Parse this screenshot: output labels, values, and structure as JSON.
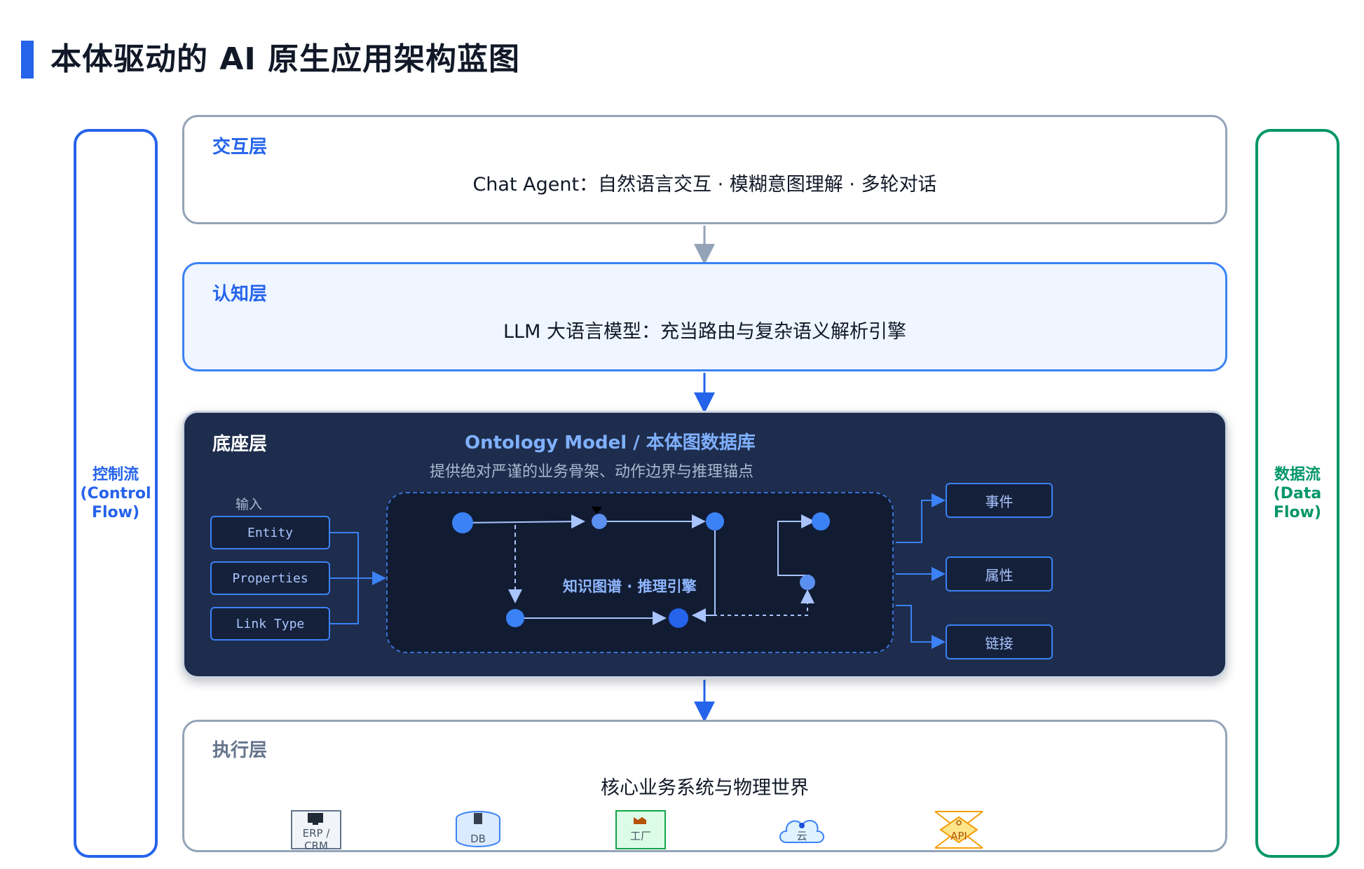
{
  "page": {
    "title": "本体驱动的 AI 原生应用架构蓝图"
  },
  "side": {
    "control": "控制流\n(Control\nFlow)",
    "data": "数据流\n(Data Flow)"
  },
  "layers": {
    "interaction": {
      "title": "交互层",
      "text": "Chat Agent：自然语言交互 · 模糊意图理解 · 多轮对话"
    },
    "cognition": {
      "title": "认知层",
      "text": "LLM 大语言模型：充当路由与复杂语义解析引擎"
    },
    "foundation": {
      "title": "底座层",
      "ontology_title": "Ontology Model / 本体图数据库",
      "ontology_subtitle": "提供绝对严谨的业务骨架、动作边界与推理锚点",
      "input_label": "输入",
      "inputs": [
        "Entity",
        "Properties",
        "Link Type"
      ],
      "kg_label": "知识图谱 · 推理引擎",
      "outputs": [
        "事件",
        "属性",
        "链接"
      ]
    },
    "execution": {
      "title": "执行层",
      "text": "核心业务系统与物理世界",
      "icons": [
        {
          "name": "computer-icon",
          "label": "ERP / CRM"
        },
        {
          "name": "database-icon",
          "label": "DB"
        },
        {
          "name": "factory-icon",
          "label": "工厂"
        },
        {
          "name": "cloud-icon",
          "label": "云"
        },
        {
          "name": "api-icon",
          "label": "API"
        }
      ]
    }
  },
  "colors": {
    "accent": "#2563eb",
    "data_flow": "#059669",
    "foundation_bg": "#1e2d4d"
  }
}
